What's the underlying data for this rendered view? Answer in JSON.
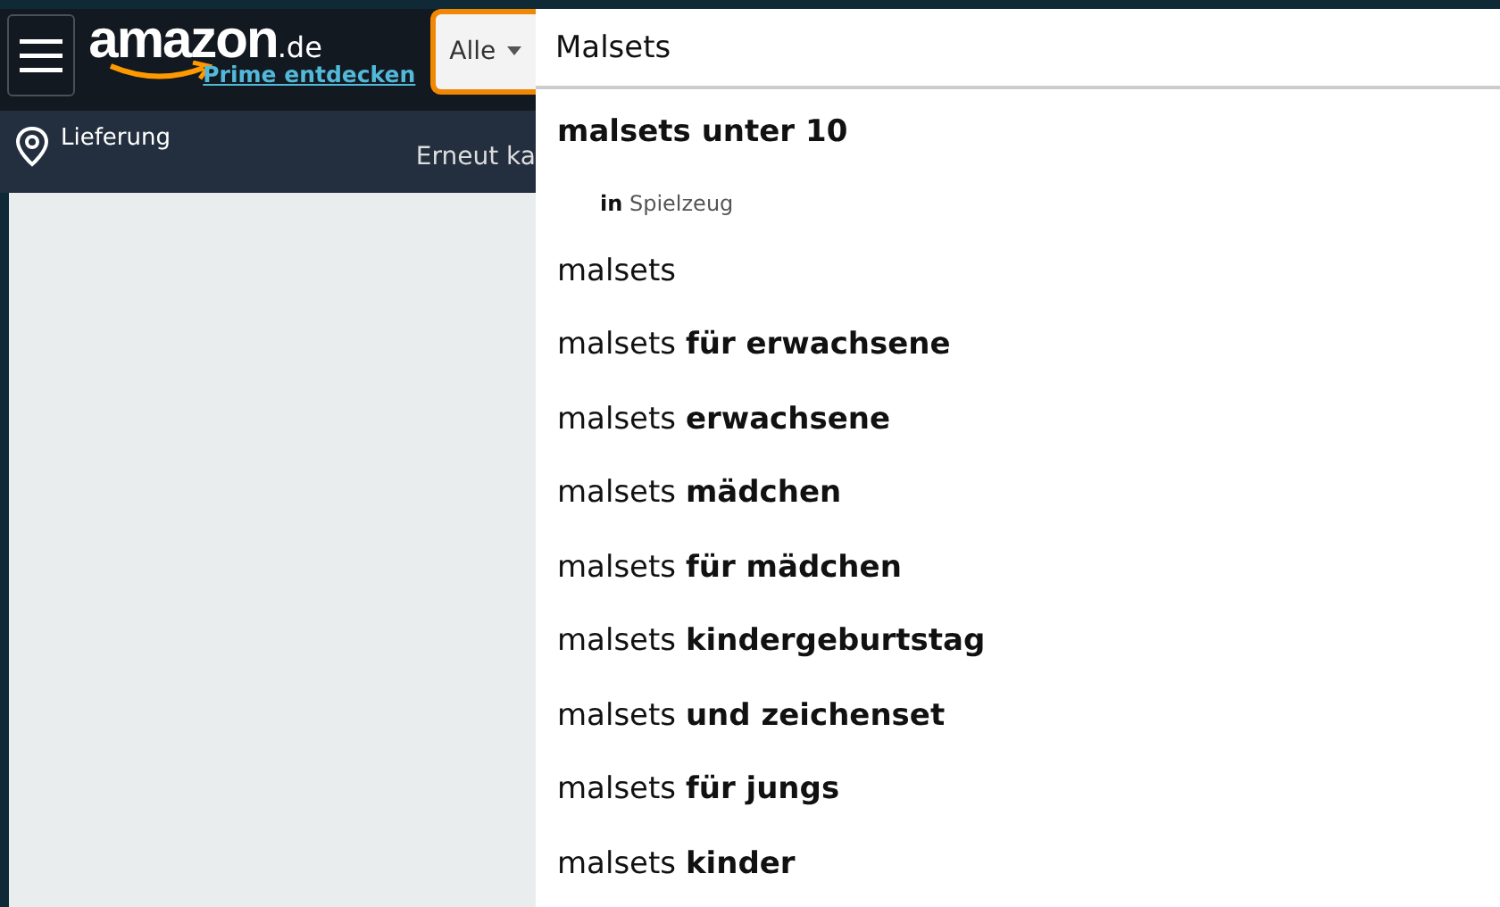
{
  "header": {
    "logo": "amazon",
    "logo_suffix": ".de",
    "prime_link": "Prime entdecken",
    "category_select": "Alle",
    "search_value": "Malsets"
  },
  "subnav": {
    "delivery": "Lieferung",
    "reorder": "Erneut ka"
  },
  "suggestions": [
    {
      "kind": "featured",
      "text": "malsets unter 10",
      "category": "**in** Spielzeug"
    },
    {
      "kind": "plain",
      "text": "malsets"
    },
    {
      "kind": "plain",
      "text": "malsets **für erwachsene**"
    },
    {
      "kind": "plain",
      "text": "malsets **erwachsene**"
    },
    {
      "kind": "plain",
      "text": "malsets **mädchen**"
    },
    {
      "kind": "plain",
      "text": "malsets **für mädchen**"
    },
    {
      "kind": "plain",
      "text": "malsets **kindergeburtstag**"
    },
    {
      "kind": "plain",
      "text": "malsets **und zeichenset**"
    },
    {
      "kind": "plain",
      "text": "malsets **für jungs**"
    },
    {
      "kind": "plain",
      "text": "malsets **kinder**"
    }
  ]
}
